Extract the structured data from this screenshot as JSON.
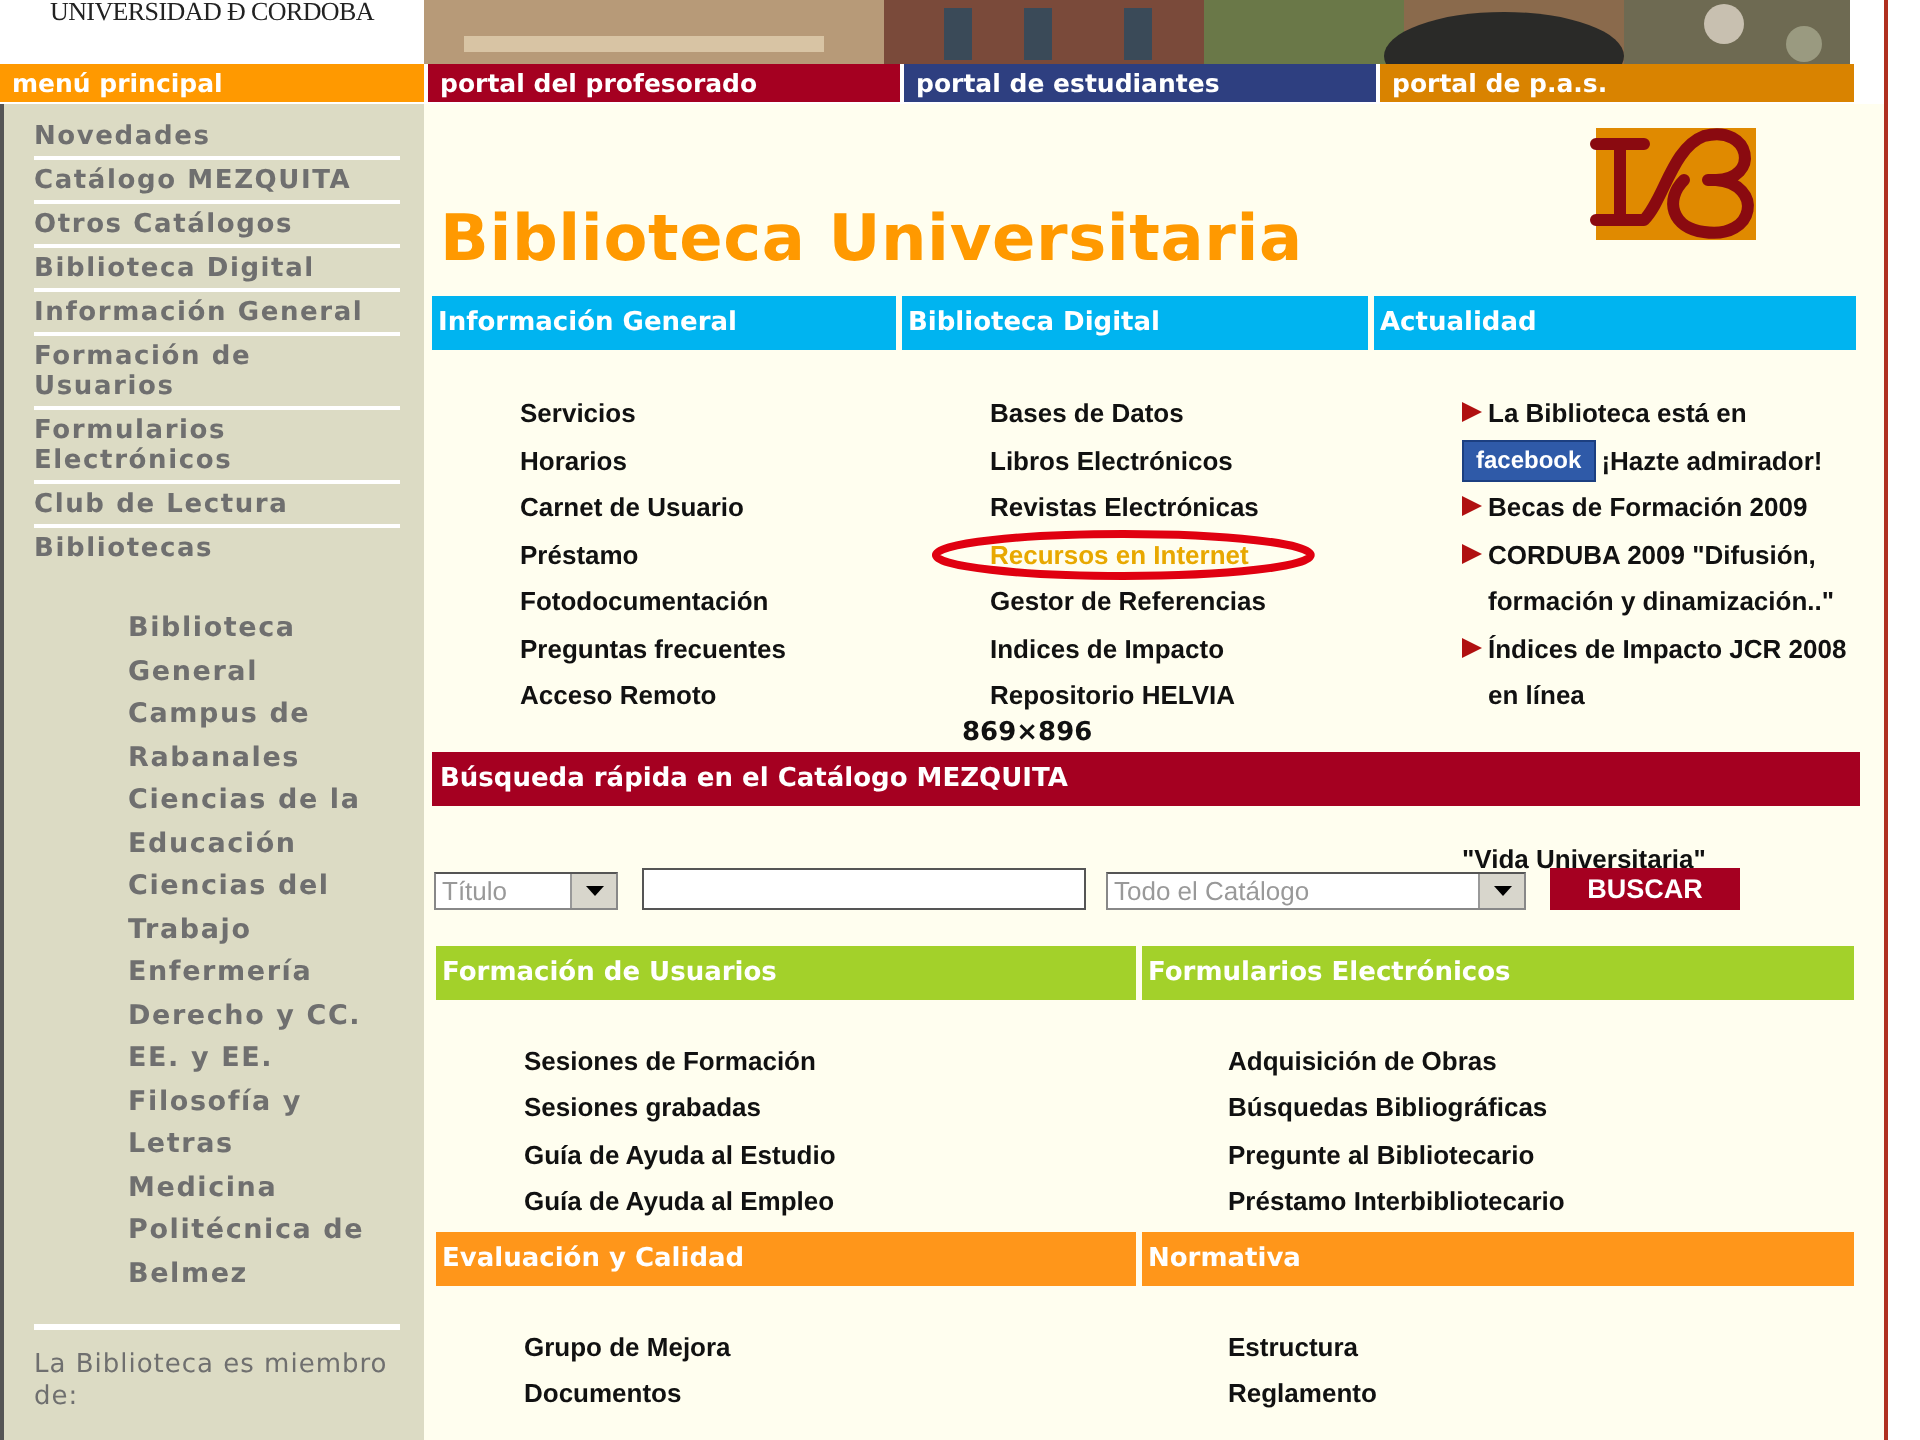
{
  "header": {
    "university": "UNIVERSIDAD Ð CORDOBA"
  },
  "nav_tabs": [
    {
      "label": "menú principal",
      "color": "#ff9900"
    },
    {
      "label": "portal del profesorado",
      "color": "#a50021"
    },
    {
      "label": "portal de estudiantes",
      "color": "#2e3f80"
    },
    {
      "label": "portal de p.a.s.",
      "color": "#d98300"
    }
  ],
  "sidebar": {
    "items": [
      {
        "label": "Novedades"
      },
      {
        "label": "Catálogo MEZQUITA"
      },
      {
        "label": "Otros Catálogos"
      },
      {
        "label": "Biblioteca Digital"
      },
      {
        "label": "Información General"
      },
      {
        "label": "Formación de Usuarios"
      },
      {
        "label": "Formularios Electrónicos"
      },
      {
        "label": "Club de Lectura"
      },
      {
        "label": "Bibliotecas",
        "children": [
          {
            "label": "Biblioteca General"
          },
          {
            "label": "Campus de Rabanales"
          },
          {
            "label": "Ciencias de la Educación"
          },
          {
            "label": "Ciencias del Trabajo"
          },
          {
            "label": "Enfermería"
          },
          {
            "label": "Derecho y CC. EE. y EE."
          },
          {
            "label": "Filosofía y Letras"
          },
          {
            "label": "Medicina"
          },
          {
            "label": "Politécnica de Belmez"
          }
        ]
      }
    ],
    "member_note": "La Biblioteca es miembro de:"
  },
  "title": "Biblioteca Universitaria",
  "top_sections": [
    {
      "heading": "Información General",
      "links": [
        {
          "label": "Servicios",
          "highlighted": false
        },
        {
          "label": "Horarios",
          "highlighted": false
        },
        {
          "label": "Carnet de Usuario",
          "highlighted": false
        },
        {
          "label": "Préstamo",
          "highlighted": false
        },
        {
          "label": "Fotodocumentación",
          "highlighted": false
        },
        {
          "label": "Preguntas frecuentes",
          "highlighted": false
        },
        {
          "label": "Acceso Remoto",
          "highlighted": false
        }
      ]
    },
    {
      "heading": "Biblioteca Digital",
      "links": [
        {
          "label": "Bases de Datos",
          "highlighted": false
        },
        {
          "label": "Libros Electrónicos",
          "highlighted": false
        },
        {
          "label": "Revistas Electrónicas",
          "highlighted": false
        },
        {
          "label": "Recursos en Internet",
          "highlighted": true
        },
        {
          "label": "Gestor de Referencias",
          "highlighted": false
        },
        {
          "label": "Indices de Impacto",
          "highlighted": false
        },
        {
          "label": "Repositorio HELVIA",
          "highlighted": false
        }
      ],
      "size_label": "869×896"
    },
    {
      "heading": "Actualidad",
      "news": [
        {
          "text": "La Biblioteca está en",
          "badge": "facebook",
          "text_after": "¡Hazte admirador!"
        },
        {
          "text": "Becas de Formación 2009"
        },
        {
          "text": "CORDUBA 2009 \"Difusión, formación y dinamización..\""
        },
        {
          "text": "Índices de Impacto JCR 2008 en línea"
        }
      ]
    }
  ],
  "search": {
    "heading": "Búsqueda rápida en el Catálogo MEZQUITA",
    "field_select": "Título",
    "scope_select": "Todo el Catálogo",
    "button": "BUSCAR",
    "news_tail": "\"Vida Universitaria\""
  },
  "bottom_sections": [
    {
      "heading": "Formación de Usuarios",
      "color": "#a3d12a",
      "links": [
        "Sesiones de Formación",
        "Sesiones grabadas",
        "Guía de Ayuda al Estudio",
        "Guía de Ayuda al Empleo"
      ]
    },
    {
      "heading": "Formularios Electrónicos",
      "color": "#a3d12a",
      "links": [
        "Adquisición de Obras",
        "Búsquedas Bibliográficas",
        "Pregunte al Bibliotecario",
        "Préstamo Interbibliotecario"
      ]
    },
    {
      "heading": "Evaluación y Calidad",
      "color": "#ff961a",
      "links": [
        "Grupo de Mejora",
        "Documentos"
      ]
    },
    {
      "heading": "Normativa",
      "color": "#ff961a",
      "links": [
        "Estructura",
        "Reglamento"
      ]
    }
  ]
}
